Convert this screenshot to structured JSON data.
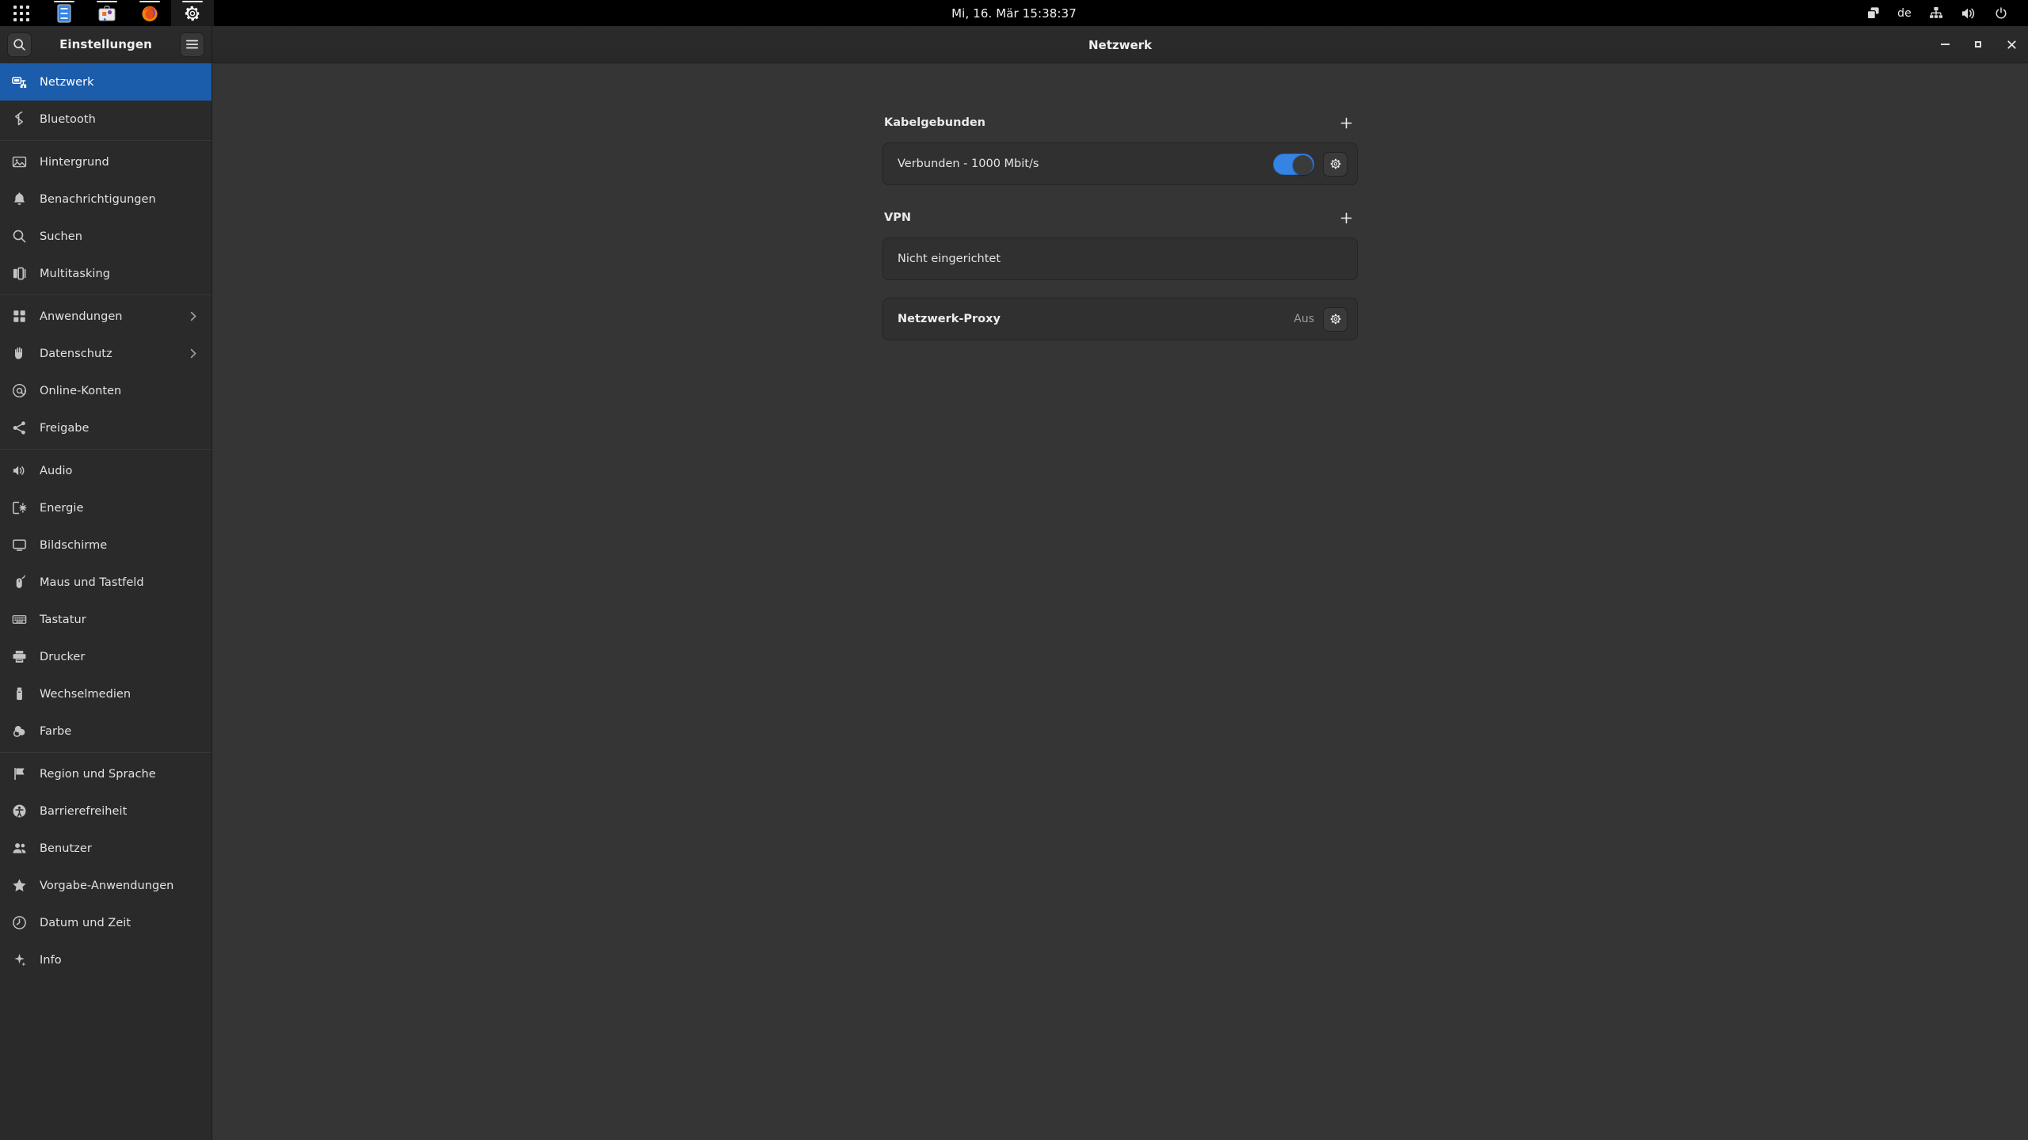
{
  "topbar": {
    "activities_icon": "app-grid-icon",
    "apps": [
      {
        "name": "text-editor",
        "icon": "text-editor-icon",
        "running": true,
        "active": false
      },
      {
        "name": "software",
        "icon": "software-center-icon",
        "running": true,
        "active": false
      },
      {
        "name": "firefox",
        "icon": "firefox-icon",
        "running": true,
        "active": false
      },
      {
        "name": "settings",
        "icon": "gear-icon",
        "running": true,
        "active": true
      }
    ],
    "clock": "Mi, 16. Mär  15:38:37",
    "keyboard_layout": "de",
    "status_icons": [
      "windows-stack-icon",
      "network-wired-icon",
      "volume-icon",
      "power-icon"
    ]
  },
  "window": {
    "sidebar_title": "Einstellungen",
    "page_title": "Netzwerk",
    "search_icon": "search-icon",
    "menu_icon": "hamburger-menu-icon",
    "controls": {
      "minimize": "minimize-icon",
      "maximize": "maximize-icon",
      "close": "close-icon"
    }
  },
  "sidebar": {
    "groups": [
      {
        "items": [
          {
            "label": "Netzwerk",
            "icon": "network-wired-icon",
            "selected": true,
            "chevron": false
          },
          {
            "label": "Bluetooth",
            "icon": "bluetooth-icon",
            "selected": false,
            "chevron": false
          }
        ]
      },
      {
        "items": [
          {
            "label": "Hintergrund",
            "icon": "wallpaper-icon",
            "selected": false,
            "chevron": false
          },
          {
            "label": "Benachrichtigungen",
            "icon": "bell-icon",
            "selected": false,
            "chevron": false
          },
          {
            "label": "Suchen",
            "icon": "search-icon",
            "selected": false,
            "chevron": false
          },
          {
            "label": "Multitasking",
            "icon": "multitasking-icon",
            "selected": false,
            "chevron": false
          }
        ]
      },
      {
        "items": [
          {
            "label": "Anwendungen",
            "icon": "apps-grid-icon",
            "selected": false,
            "chevron": true
          },
          {
            "label": "Datenschutz",
            "icon": "hand-privacy-icon",
            "selected": false,
            "chevron": true
          },
          {
            "label": "Online-Konten",
            "icon": "at-sign-icon",
            "selected": false,
            "chevron": false
          },
          {
            "label": "Freigabe",
            "icon": "share-icon",
            "selected": false,
            "chevron": false
          }
        ]
      },
      {
        "items": [
          {
            "label": "Audio",
            "icon": "volume-icon",
            "selected": false,
            "chevron": false
          },
          {
            "label": "Energie",
            "icon": "battery-power-icon",
            "selected": false,
            "chevron": false
          },
          {
            "label": "Bildschirme",
            "icon": "display-icon",
            "selected": false,
            "chevron": false
          },
          {
            "label": "Maus und Tastfeld",
            "icon": "mouse-icon",
            "selected": false,
            "chevron": false
          },
          {
            "label": "Tastatur",
            "icon": "keyboard-icon",
            "selected": false,
            "chevron": false
          },
          {
            "label": "Drucker",
            "icon": "printer-icon",
            "selected": false,
            "chevron": false
          },
          {
            "label": "Wechselmedien",
            "icon": "usb-drive-icon",
            "selected": false,
            "chevron": false
          },
          {
            "label": "Farbe",
            "icon": "color-icon",
            "selected": false,
            "chevron": false
          }
        ]
      },
      {
        "items": [
          {
            "label": "Region und Sprache",
            "icon": "flag-icon",
            "selected": false,
            "chevron": false
          },
          {
            "label": "Barrierefreiheit",
            "icon": "accessibility-icon",
            "selected": false,
            "chevron": false
          },
          {
            "label": "Benutzer",
            "icon": "users-icon",
            "selected": false,
            "chevron": false
          },
          {
            "label": "Vorgabe-Anwendungen",
            "icon": "star-icon",
            "selected": false,
            "chevron": false
          },
          {
            "label": "Datum und Zeit",
            "icon": "clock-icon",
            "selected": false,
            "chevron": false
          },
          {
            "label": "Info",
            "icon": "info-sparkle-icon",
            "selected": false,
            "chevron": false
          }
        ]
      }
    ]
  },
  "main": {
    "wired": {
      "title": "Kabelgebunden",
      "add_icon": "plus-icon",
      "connection_label": "Verbunden - 1000 Mbit/s",
      "toggle_on": true,
      "settings_icon": "gear-icon"
    },
    "vpn": {
      "title": "VPN",
      "add_icon": "plus-icon",
      "empty_label": "Nicht eingerichtet"
    },
    "proxy": {
      "label": "Netzwerk-Proxy",
      "value": "Aus",
      "settings_icon": "gear-icon"
    }
  },
  "colors": {
    "accent": "#3584e4",
    "selection": "#1b5cab",
    "topbar_bg": "#000000",
    "sidebar_bg": "#2a2a2a",
    "content_bg": "#353535",
    "card_bg": "#303030"
  }
}
